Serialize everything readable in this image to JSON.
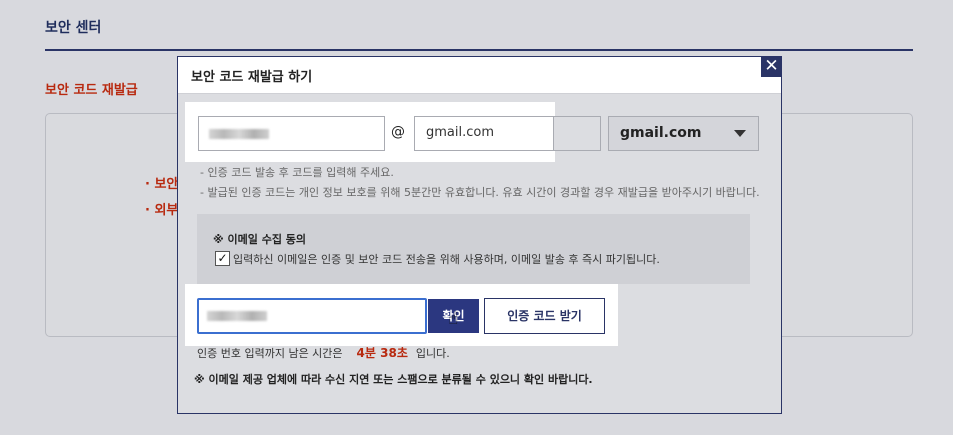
{
  "page": {
    "title": "보안 센터",
    "subtitle": "보안 코드 재발급",
    "bullets": [
      "보안",
      "외부"
    ]
  },
  "modal": {
    "title": "보안 코드 재발급 하기",
    "close_label": "✕",
    "email": {
      "at": "@",
      "domain_value": "gmail.com",
      "domain_select": "gmail.com"
    },
    "notes": [
      "- 인증 코드 발송 후 코드를 입력해 주세요.",
      "- 발급된 인증 코드는 개인 정보 보호를 위해 5분간만 유효합니다. 유효 시간이 경과할 경우 재발급을 받아주시기 바랍니다."
    ],
    "consent": {
      "title": "※ 이메일 수집 동의",
      "checked": true,
      "check_mark": "✓",
      "text": "입력하신 이메일은 인증 및 보안 코드 전송을 위해 사용하며, 이메일 발송 후 즉시 파기됩니다."
    },
    "code": {
      "confirm_label": "확인",
      "get_code_label": "인증 코드 받기"
    },
    "timer": {
      "prefix": "인증 번호 입력까지 남은 시간은",
      "value": "4분 38초",
      "suffix": "입니다."
    },
    "warning": "※ 이메일 제공 업체에 따라 수신 지연 또는 스팸으로 분류될 수 있으니 확인 바랍니다."
  },
  "colors": {
    "navy": "#2a3466",
    "accent_red": "#b8290f",
    "focus_blue": "#3b6fd0"
  }
}
